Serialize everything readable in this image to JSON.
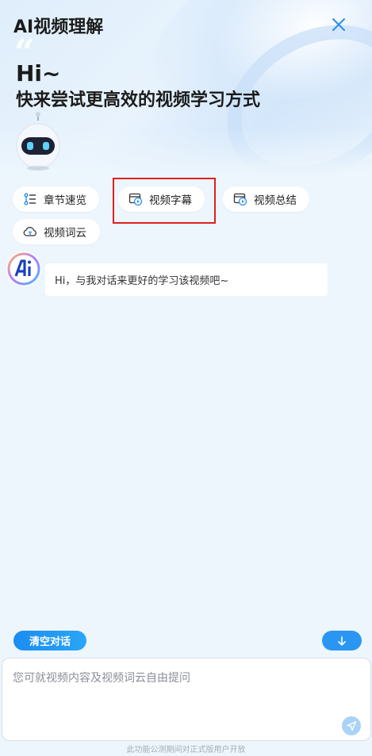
{
  "header": {
    "title": "AI视频理解",
    "greeting": "Hi~",
    "subtitle": "快来尝试更高效的视频学习方式",
    "close_icon": "close-icon"
  },
  "features": [
    {
      "label": "章节速览",
      "icon": "chapter-list-icon"
    },
    {
      "label": "视频字幕",
      "icon": "video-subtitle-icon"
    },
    {
      "label": "视频总结",
      "icon": "video-summary-icon"
    },
    {
      "label": "视频词云",
      "icon": "word-cloud-icon"
    }
  ],
  "chat": {
    "messages": [
      {
        "role": "assistant",
        "text": "Hi，与我对话来更好的学习该视频吧~"
      }
    ]
  },
  "actions": {
    "clear_label": "清空对话",
    "scroll_down_icon": "arrow-down-icon"
  },
  "composer": {
    "placeholder": "您可就视频内容及视频词云自由提问",
    "value": "",
    "send_icon": "send-icon"
  },
  "footer": {
    "note": "此功能公测期间对正式版用户开放"
  },
  "colors": {
    "accent": "#1c8cf2",
    "highlight": "#e0201b",
    "background": "#edf6fd"
  }
}
